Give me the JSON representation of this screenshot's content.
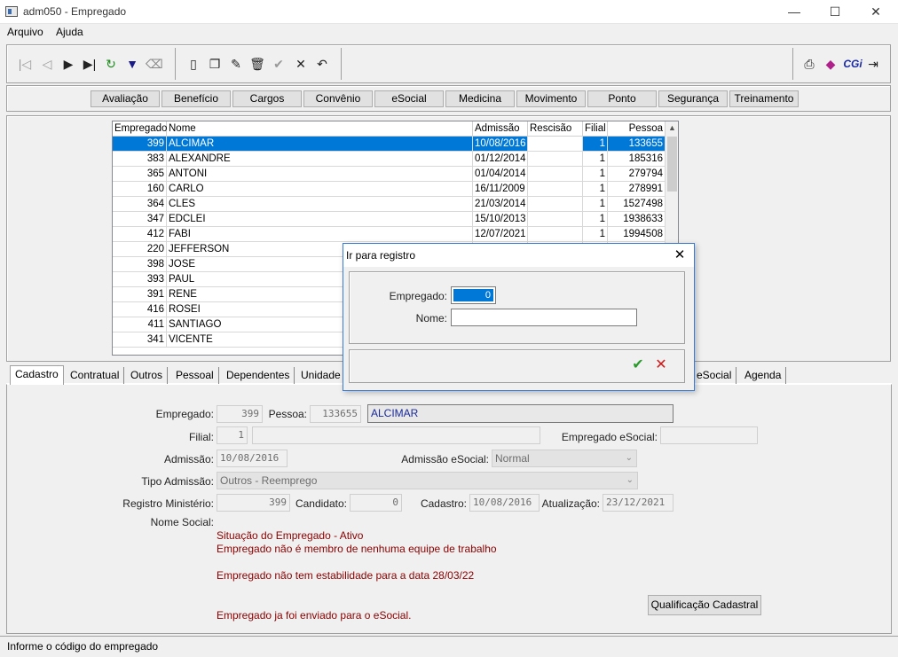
{
  "window": {
    "title": "adm050 - Empregado",
    "minimize": "—",
    "maximize": "☐",
    "close": "✕"
  },
  "menu": [
    "Arquivo",
    "Ajuda"
  ],
  "toolbar": {
    "nav_icons": [
      "first-icon",
      "prev-icon",
      "next-icon",
      "last-icon",
      "refresh-icon",
      "filter-icon",
      "clear-filter-icon"
    ],
    "edit_icons": [
      "new-icon",
      "copy-icon",
      "edit-icon",
      "delete-icon",
      "confirm-icon",
      "cancel-icon",
      "undo-icon"
    ],
    "right_icons": [
      "print-icon",
      "book-icon",
      "cgi-icon",
      "exit-icon"
    ],
    "cgi_label": "CGi"
  },
  "modules": [
    "Avaliação",
    "Benefício",
    "Cargos",
    "Convênio",
    "eSocial",
    "Medicina",
    "Movimento",
    "Ponto",
    "Segurança",
    "Treinamento"
  ],
  "grid": {
    "columns": [
      "Empregado",
      "Nome",
      "Admissão",
      "Rescisão",
      "Filial",
      "Pessoa"
    ],
    "rows": [
      [
        "399",
        "ALCIMAR",
        "10/08/2016",
        "",
        "1",
        "133655"
      ],
      [
        "383",
        "ALEXANDRE",
        "01/12/2014",
        "",
        "1",
        "185316"
      ],
      [
        "365",
        "ANTONI",
        "01/04/2014",
        "",
        "1",
        "279794"
      ],
      [
        "160",
        "CARLO",
        "16/11/2009",
        "",
        "1",
        "278991"
      ],
      [
        "364",
        "CLES",
        "21/03/2014",
        "",
        "1",
        "1527498"
      ],
      [
        "347",
        "EDCLEI",
        "15/10/2013",
        "",
        "1",
        "1938633"
      ],
      [
        "412",
        "FABI",
        "12/07/2021",
        "",
        "1",
        "1994508"
      ],
      [
        "220",
        "JEFFERSON",
        "",
        "",
        "",
        ""
      ],
      [
        "398",
        "JOSE",
        "",
        "",
        "",
        ""
      ],
      [
        "393",
        "PAUL",
        "",
        "",
        "",
        ""
      ],
      [
        "391",
        "RENE",
        "",
        "",
        "",
        ""
      ],
      [
        "416",
        "ROSEI",
        "",
        "",
        "",
        ""
      ],
      [
        "411",
        "SANTIAGO",
        "",
        "",
        "",
        ""
      ],
      [
        "341",
        "VICENTE",
        "",
        "",
        "",
        ""
      ]
    ],
    "selected_index": 0
  },
  "tabs": [
    "Cadastro",
    "Contratual",
    "Outros",
    "Pessoal",
    "Dependentes",
    "Unidade",
    "eSocial",
    "Agenda"
  ],
  "form": {
    "empregado_label": "Empregado:",
    "empregado": "399",
    "pessoa_label": "Pessoa:",
    "pessoa": "133655",
    "nome": "ALCIMAR",
    "filial_label": "Filial:",
    "filial": "1",
    "filial_nome": "",
    "empregado_esocial_label": "Empregado eSocial:",
    "empregado_esocial": "",
    "admissao_label": "Admissão:",
    "admissao": "10/08/2016",
    "admissao_esocial_label": "Admissão eSocial:",
    "admissao_esocial": "Normal",
    "tipo_admissao_label": "Tipo Admissão:",
    "tipo_admissao": "Outros - Reemprego",
    "registro_label": "Registro Ministério:",
    "registro": "399",
    "candidato_label": "Candidato:",
    "candidato": "0",
    "cadastro_label": "Cadastro:",
    "cadastro": "10/08/2016",
    "atualizacao_label": "Atualização:",
    "atualizacao": "23/12/2021",
    "nome_social_label": "Nome Social:",
    "messages": [
      "Situação do Empregado - Ativo",
      "Empregado não é membro de nenhuma equipe de trabalho",
      "Empregado não tem estabilidade para a data 28/03/22",
      "Empregado ja foi enviado para o eSocial."
    ],
    "qualificacao_button": "Qualificação Cadastral"
  },
  "dialog": {
    "title": "Ir para registro",
    "empregado_label": "Empregado:",
    "empregado": "0",
    "nome_label": "Nome:",
    "nome": "",
    "confirm": "✔",
    "cancel": "✕",
    "close": "✕"
  },
  "status": "Informe o código do empregado",
  "colors": {
    "selection": "#0078d7",
    "message": "#8b0000",
    "accent": "#3a7bd5"
  }
}
